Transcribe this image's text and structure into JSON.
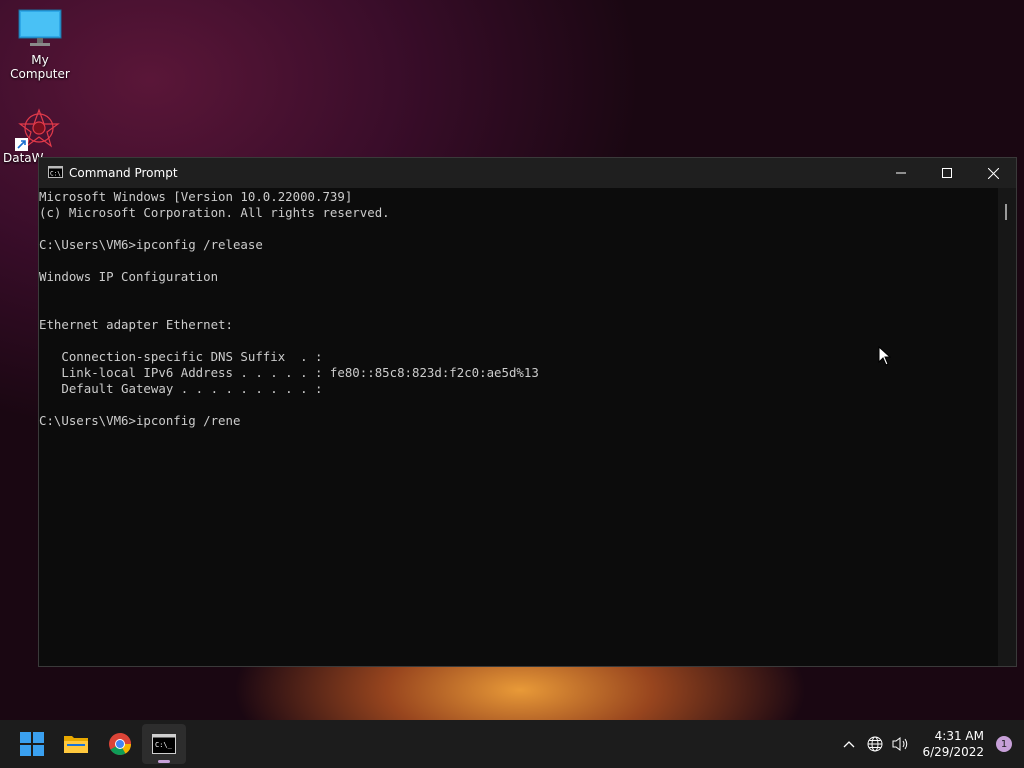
{
  "desktop": {
    "icons": [
      {
        "label": "My Computer",
        "icon": "monitor-icon"
      },
      {
        "label": "DataW",
        "icon": "datawrapper-shortcut-icon"
      }
    ]
  },
  "window": {
    "title": "Command Prompt",
    "controls": {
      "minimize": "minimize-icon",
      "maximize": "maximize-icon",
      "close": "close-icon"
    },
    "lines": [
      "Microsoft Windows [Version 10.0.22000.739]",
      "(c) Microsoft Corporation. All rights reserved.",
      "",
      "C:\\Users\\VM6>ipconfig /release",
      "",
      "Windows IP Configuration",
      "",
      "",
      "Ethernet adapter Ethernet:",
      "",
      "   Connection-specific DNS Suffix  . :",
      "   Link-local IPv6 Address . . . . . : fe80::85c8:823d:f2c0:ae5d%13",
      "   Default Gateway . . . . . . . . . :",
      "",
      "C:\\Users\\VM6>ipconfig /rene"
    ]
  },
  "taskbar": {
    "apps": [
      {
        "name": "start",
        "icon": "windows-logo-icon"
      },
      {
        "name": "file-explorer",
        "icon": "folder-icon"
      },
      {
        "name": "chrome",
        "icon": "chrome-icon"
      },
      {
        "name": "command-prompt",
        "icon": "terminal-icon",
        "active": true
      }
    ],
    "tray": {
      "time": "4:31 AM",
      "date": "6/29/2022",
      "notification_count": "1"
    }
  },
  "colors": {
    "console_bg": "#0c0c0c",
    "console_text": "#cccccc",
    "titlebar": "#1f1f1f",
    "taskbar": "#1c1c1c",
    "accent": "#c7a0d8"
  }
}
